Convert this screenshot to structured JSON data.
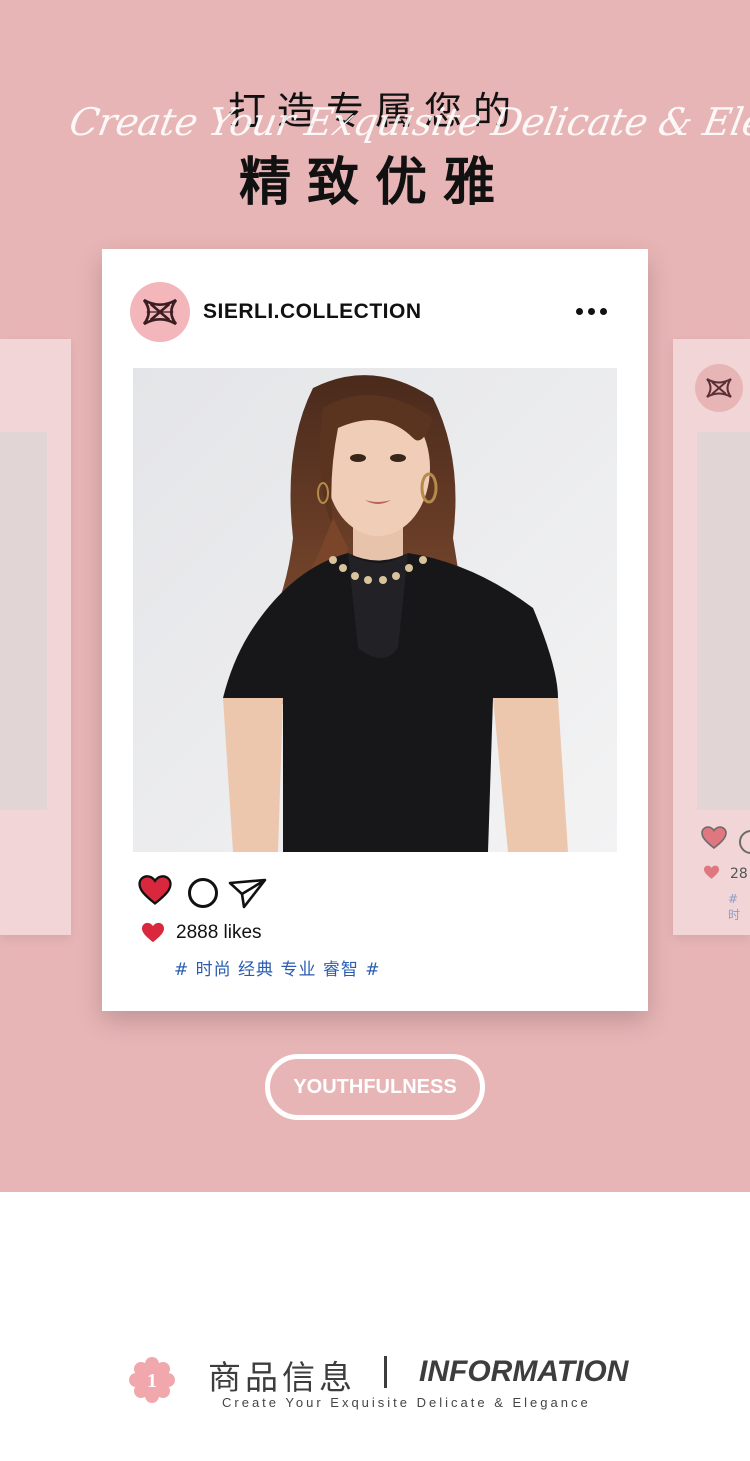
{
  "headline": {
    "line1": "打造专属您的",
    "script": "Create Your Exquisite Delicate & Elegance",
    "line2": "精致优雅"
  },
  "post": {
    "account_name": "SIERLI.COLLECTION",
    "likes": "2888 likes",
    "tags": "# 时尚 经典 专业 睿智 #"
  },
  "ghost_card": {
    "likes": "28",
    "tag": "# 时"
  },
  "badge": {
    "label": "YOUTHFULNESS"
  },
  "section": {
    "number": "1",
    "title_cn": "商品信息",
    "title_en": "INFORMATION",
    "subtitle": "Create Your Exquisite Delicate & Elegance"
  },
  "colors": {
    "background_pink": "#e8b5b6",
    "heart_red": "#d9283d",
    "tag_blue": "#2a5db2"
  }
}
